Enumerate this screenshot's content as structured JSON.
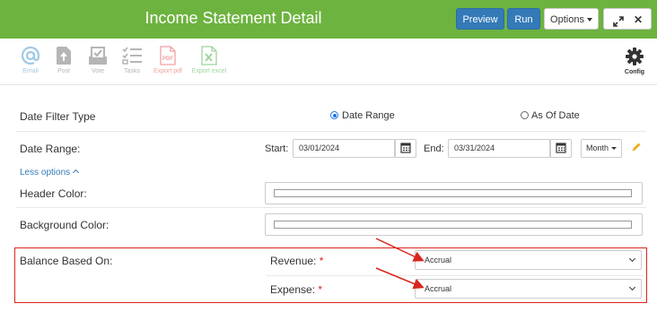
{
  "header": {
    "title": "Income Statement Detail",
    "preview_label": "Preview",
    "run_label": "Run",
    "options_label": "Options",
    "close_symbol": "✕"
  },
  "toolbar": {
    "email": "Email",
    "post": "Post",
    "vote": "Vote",
    "tasks": "Tasks",
    "export_pdf": "Export pdf",
    "pdf_icon_text": "PDF",
    "export_excel": "Export excel",
    "config": "Config"
  },
  "form": {
    "date_filter_type": {
      "label": "Date Filter Type",
      "options": [
        "Date Range",
        "As Of Date"
      ],
      "selected": "Date Range"
    },
    "date_range": {
      "label": "Date Range:",
      "start_label": "Start:",
      "start_value": "03/01/2024",
      "end_label": "End:",
      "end_value": "03/31/2024",
      "period_label": "Month"
    },
    "less_options": "Less options",
    "header_color": {
      "label": "Header Color:"
    },
    "background_color": {
      "label": "Background Color:"
    },
    "balance_based_on": {
      "label": "Balance Based On:",
      "revenue_label": "Revenue:",
      "revenue_value": "Accrual",
      "expense_label": "Expense:",
      "expense_value": "Accrual",
      "required_mark": "*"
    }
  },
  "colors": {
    "header_bg": "#6db33f",
    "primary_button": "#337ab7",
    "highlight_border": "#d9251d",
    "annotation_arrow": "#d9251d"
  }
}
